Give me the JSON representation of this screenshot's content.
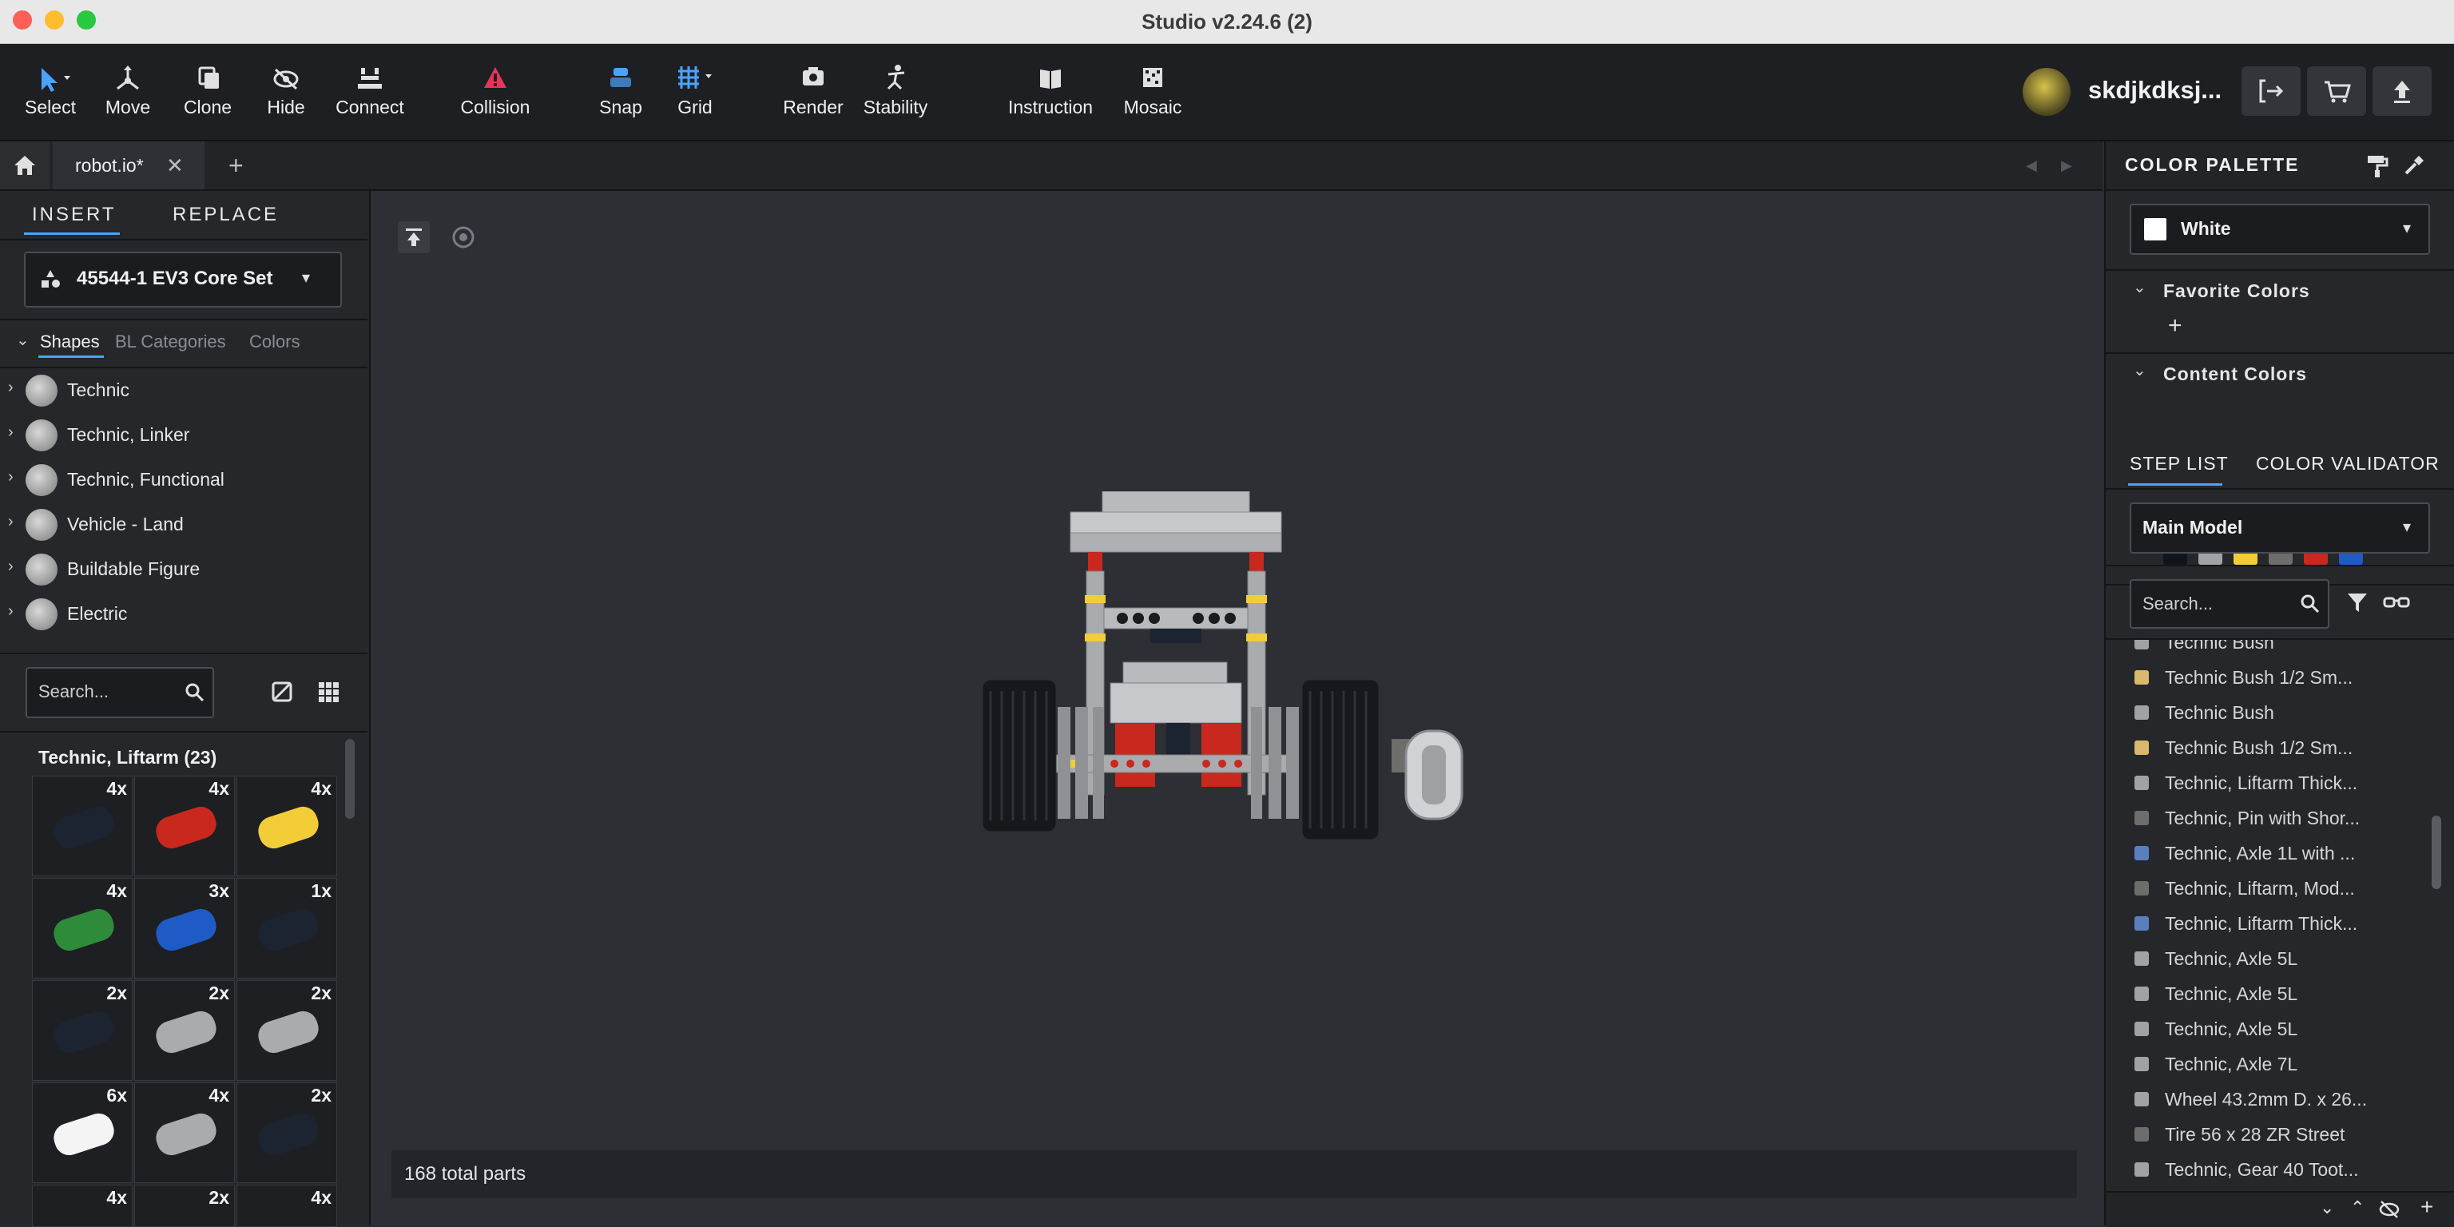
{
  "window": {
    "title": "Studio v2.24.6 (2)"
  },
  "toolbar": {
    "tools": [
      {
        "label": "Select",
        "icon": "cursor-icon"
      },
      {
        "label": "Move",
        "icon": "move-icon"
      },
      {
        "label": "Clone",
        "icon": "clone-icon"
      },
      {
        "label": "Hide",
        "icon": "eye-slash-icon"
      },
      {
        "label": "Connect",
        "icon": "connect-icon"
      },
      {
        "label": "Collision",
        "icon": "warning-icon"
      },
      {
        "label": "Snap",
        "icon": "snap-icon"
      },
      {
        "label": "Grid",
        "icon": "grid-icon"
      },
      {
        "label": "Render",
        "icon": "camera-icon"
      },
      {
        "label": "Stability",
        "icon": "stability-icon"
      },
      {
        "label": "Instruction",
        "icon": "book-icon"
      },
      {
        "label": "Mosaic",
        "icon": "mosaic-icon"
      }
    ],
    "username": "skdjkdksj..."
  },
  "tabs": {
    "file_tab": "robot.io*"
  },
  "insert_panel": {
    "tab_insert": "INSERT",
    "tab_replace": "REPLACE",
    "set_selector": "45544-1 EV3 Core Set",
    "subtabs": [
      "Shapes",
      "BL Categories",
      "Colors"
    ],
    "categories": [
      "Technic",
      "Technic, Linker",
      "Technic, Functional",
      "Vehicle - Land",
      "Buildable Figure",
      "Electric"
    ],
    "search_placeholder": "Search...",
    "group_title": "Technic, Liftarm (23)",
    "parts": [
      {
        "count": "4x",
        "color": "#1b2430"
      },
      {
        "count": "4x",
        "color": "#c9281e"
      },
      {
        "count": "4x",
        "color": "#f2cd37"
      },
      {
        "count": "4x",
        "color": "#2e8b3a"
      },
      {
        "count": "3x",
        "color": "#1f5bc6"
      },
      {
        "count": "1x",
        "color": "#1b2430"
      },
      {
        "count": "2x",
        "color": "#1b2430"
      },
      {
        "count": "2x",
        "color": "#a9abad"
      },
      {
        "count": "2x",
        "color": "#a9abad"
      },
      {
        "count": "6x",
        "color": "#f4f4f4"
      },
      {
        "count": "4x",
        "color": "#a9abad"
      },
      {
        "count": "2x",
        "color": "#1b2430"
      },
      {
        "count": "4x",
        "color": "#a9abad"
      },
      {
        "count": "2x",
        "color": "#a9abad"
      },
      {
        "count": "4x",
        "color": "#a9abad"
      }
    ]
  },
  "viewport": {
    "status": "168 total parts"
  },
  "color_palette": {
    "title": "COLOR PALETTE",
    "selected_color": "White",
    "favorite_colors_label": "Favorite Colors",
    "content_colors_label": "Content Colors",
    "content_colors": [
      "#0f151c",
      "#a0a3a6",
      "#f2cd37",
      "#6d6e6c",
      "#c9281e",
      "#1f5bc6"
    ]
  },
  "step_list": {
    "tab_step_list": "STEP LIST",
    "tab_color_validator": "COLOR VALIDATOR",
    "model_selector": "Main Model",
    "search_placeholder": "Search...",
    "items": [
      {
        "label": "Technic Bush",
        "color": "#a0a3a6"
      },
      {
        "label": "Technic Bush 1/2 Sm...",
        "color": "#d9b96b"
      },
      {
        "label": "Technic Bush",
        "color": "#a0a3a6"
      },
      {
        "label": "Technic Bush 1/2 Sm...",
        "color": "#d9b96b"
      },
      {
        "label": "Technic, Liftarm Thick...",
        "color": "#a0a3a6"
      },
      {
        "label": "Technic, Pin with Shor...",
        "color": "#6d6e6c"
      },
      {
        "label": "Technic, Axle  1L with ...",
        "color": "#5a7fbf"
      },
      {
        "label": "Technic, Liftarm, Mod...",
        "color": "#6d6e6c"
      },
      {
        "label": "Technic, Liftarm Thick...",
        "color": "#5a7fbf"
      },
      {
        "label": "Technic, Axle  5L",
        "color": "#a0a3a6"
      },
      {
        "label": "Technic, Axle  5L",
        "color": "#a0a3a6"
      },
      {
        "label": "Technic, Axle  5L",
        "color": "#a0a3a6"
      },
      {
        "label": "Technic, Axle  7L",
        "color": "#a0a3a6"
      },
      {
        "label": "Wheel 43.2mm D. x 26...",
        "color": "#a0a3a6"
      },
      {
        "label": "Tire 56 x 28 ZR Street",
        "color": "#6d6e6c"
      },
      {
        "label": "Technic, Gear 40 Toot...",
        "color": "#a0a3a6"
      }
    ]
  }
}
